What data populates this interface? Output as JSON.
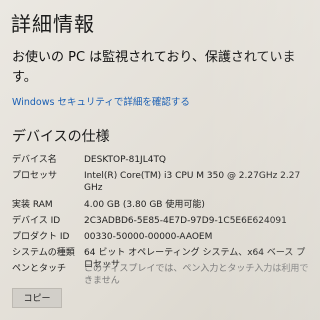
{
  "page": {
    "title": "詳細情報"
  },
  "notice": {
    "text": "お使いの PC は監視されており、保護されています。"
  },
  "security_link": {
    "label": "Windows セキュリティで詳細を確認する"
  },
  "device_specs": {
    "title": "デバイスの仕様",
    "rows": [
      {
        "label": "デバイス名",
        "value": "DESKTOP-81JL4TQ"
      },
      {
        "label": "プロセッサ",
        "value": "Intel(R) Core(TM) i3 CPU       M 350 @ 2.27GHz   2.27 GHz"
      },
      {
        "label": "実装 RAM",
        "value": "4.00 GB (3.80 GB 使用可能)"
      },
      {
        "label": "デバイス ID",
        "value": "2C3ADBD6-5E85-4E7D-97D9-1C5E6E624091"
      },
      {
        "label": "プロダクト ID",
        "value": "00330-50000-00000-AAOEM"
      },
      {
        "label": "システムの種類",
        "value": "64 ビット オペレーティング システム、x64 ベース プロセッサ"
      },
      {
        "label": "ペンとタッチ",
        "value": "このディスプレイでは、ペン入力とタッチ入力は利用できません"
      }
    ]
  },
  "copy_button": {
    "label": "コピー"
  },
  "colors": {
    "background": "#e4e1da",
    "link": "#1a5fb4",
    "text": "#1a1a1a"
  }
}
